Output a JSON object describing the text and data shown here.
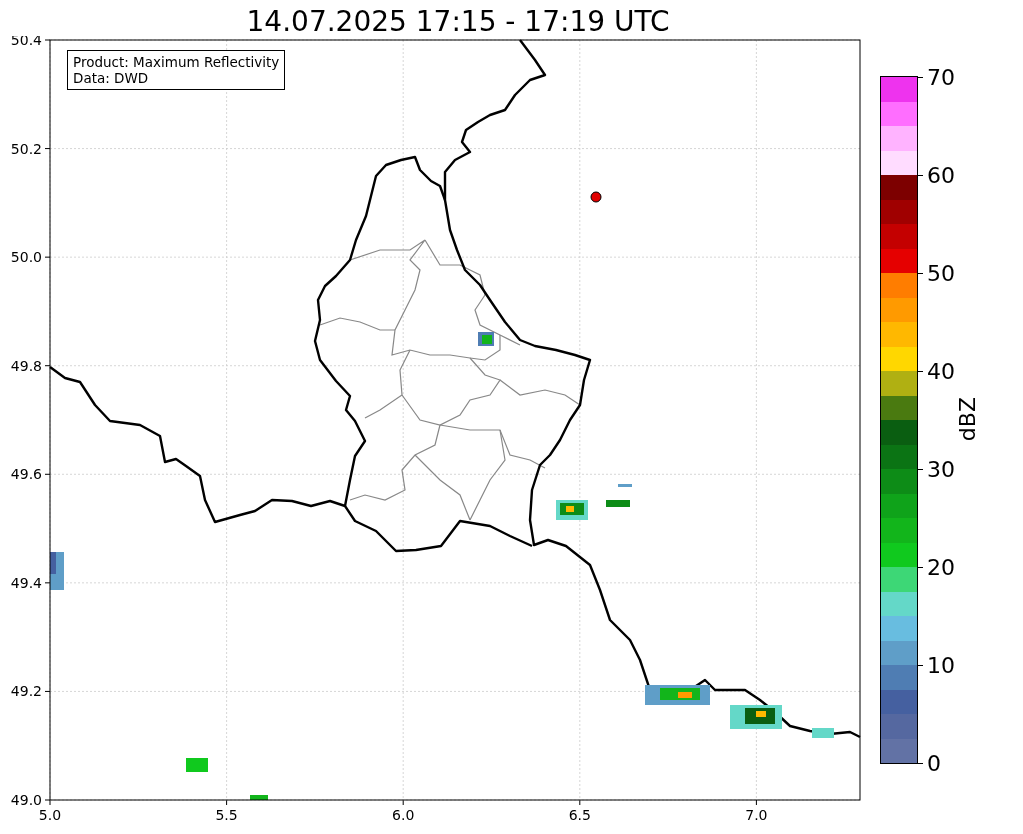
{
  "title": "14.07.2025 17:15 - 17:19 UTC",
  "info_box": [
    "Product: Maximum Reflectivity",
    "Data: DWD"
  ],
  "x_ticks": [
    "5.0",
    "5.5",
    "6.0",
    "6.5",
    "7.0"
  ],
  "y_ticks": [
    "50.4",
    "50.2",
    "50.0",
    "49.8",
    "49.6",
    "49.4",
    "49.2",
    "49.0"
  ],
  "colorbar": {
    "label": "dBZ",
    "ticks": [
      "70",
      "60",
      "50",
      "40",
      "30",
      "20",
      "10",
      "0"
    ],
    "bins": [
      {
        "color": "#ee33ee"
      },
      {
        "color": "#ff6eff"
      },
      {
        "color": "#ffb3ff"
      },
      {
        "color": "#ffdcff"
      },
      {
        "color": "#7d0000"
      },
      {
        "color": "#a00000"
      },
      {
        "color": "#c40000"
      },
      {
        "color": "#e50000"
      },
      {
        "color": "#ff7d00"
      },
      {
        "color": "#ff9a00"
      },
      {
        "color": "#ffb800"
      },
      {
        "color": "#ffd700"
      },
      {
        "color": "#b0b012"
      },
      {
        "color": "#4a7a10"
      },
      {
        "color": "#0a5e11"
      },
      {
        "color": "#0b7414"
      },
      {
        "color": "#0d8c17"
      },
      {
        "color": "#0fa31a"
      },
      {
        "color": "#12b51b"
      },
      {
        "color": "#10c91e"
      },
      {
        "color": "#3dd776"
      },
      {
        "color": "#64d8c8"
      },
      {
        "color": "#68bde0"
      },
      {
        "color": "#5f9ec8"
      },
      {
        "color": "#4f7db3"
      },
      {
        "color": "#4560a0"
      },
      {
        "color": "#5568a0"
      },
      {
        "color": "#6272a5"
      }
    ]
  }
}
